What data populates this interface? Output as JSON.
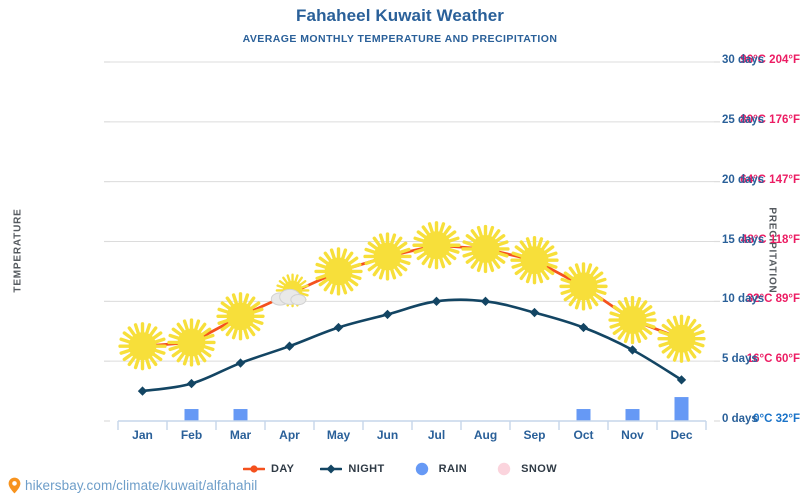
{
  "header": {
    "title": "Fahaheel Kuwait Weather",
    "subtitle": "AVERAGE MONTHLY TEMPERATURE AND PRECIPITATION"
  },
  "axes": {
    "left_title": "TEMPERATURE",
    "right_title": "PRECIPITATION"
  },
  "footer": {
    "url": "hikersbay.com/climate/kuwait/alfahahil",
    "pin_icon": "map-pin-icon"
  },
  "legend": {
    "items": [
      {
        "label": "DAY",
        "icon": "line-marker-icon",
        "color": "#f4511e"
      },
      {
        "label": "NIGHT",
        "icon": "line-marker-icon",
        "color": "#134563"
      },
      {
        "label": "RAIN",
        "icon": "circle-icon",
        "color": "#6699f5"
      },
      {
        "label": "SNOW",
        "icon": "circle-icon",
        "color": "#fbd4dd"
      }
    ]
  },
  "colors": {
    "day_line": "#f4511e",
    "night_line": "#134563",
    "rain_bar": "#6699f5",
    "snow": "#fbd4dd",
    "grid": "#dcdcdc",
    "axis_text_temp": "#ec1c63",
    "axis_text_precip": "#2a6099",
    "title": "#2a6099",
    "sun": "#f7df3a"
  },
  "chart_data": {
    "type": "line",
    "title": "Fahaheel Kuwait Weather",
    "subtitle": "AVERAGE MONTHLY TEMPERATURE AND PRECIPITATION",
    "xlabel": "",
    "ylabel": "TEMPERATURE",
    "y2label": "PRECIPITATION",
    "grid": true,
    "legend_position": "bottom",
    "categories": [
      "Jan",
      "Feb",
      "Mar",
      "Apr",
      "May",
      "Jun",
      "Jul",
      "Aug",
      "Sep",
      "Oct",
      "Nov",
      "Dec"
    ],
    "ylim": [
      0,
      96
    ],
    "y2lim": [
      0,
      30
    ],
    "yticks_left": [
      {
        "value": 0,
        "label": "0°C 32°F"
      },
      {
        "value": 16,
        "label": "16°C 60°F"
      },
      {
        "value": 32,
        "label": "32°C 89°F"
      },
      {
        "value": 48,
        "label": "48°C 118°F"
      },
      {
        "value": 64,
        "label": "64°C 147°F"
      },
      {
        "value": 80,
        "label": "80°C 176°F"
      },
      {
        "value": 96,
        "label": "96°C 204°F"
      }
    ],
    "yticks_right": [
      {
        "value": 0,
        "label": "0 days"
      },
      {
        "value": 5,
        "label": "5 days"
      },
      {
        "value": 10,
        "label": "10 days"
      },
      {
        "value": 15,
        "label": "15 days"
      },
      {
        "value": 20,
        "label": "20 days"
      },
      {
        "value": 25,
        "label": "25 days"
      },
      {
        "value": 30,
        "label": "30 days"
      }
    ],
    "series": [
      {
        "name": "DAY",
        "unit": "°C",
        "axis": "left",
        "color": "#f4511e",
        "values": [
          20,
          21,
          28,
          34,
          40,
          44,
          47,
          46,
          43,
          36,
          27,
          22
        ]
      },
      {
        "name": "NIGHT",
        "unit": "°C",
        "axis": "left",
        "color": "#134563",
        "values": [
          8,
          10,
          15.5,
          20,
          25,
          28.5,
          32,
          32,
          29,
          25,
          19,
          11
        ]
      },
      {
        "name": "RAIN",
        "unit": "days",
        "axis": "right",
        "type": "bar",
        "color": "#6699f5",
        "values": [
          0,
          1,
          1,
          0,
          0,
          0,
          0,
          0,
          0,
          1,
          1,
          2
        ]
      },
      {
        "name": "SNOW",
        "unit": "days",
        "axis": "right",
        "type": "bar",
        "color": "#fbd4dd",
        "values": [
          0,
          0,
          0,
          0,
          0,
          0,
          0,
          0,
          0,
          0,
          0,
          0
        ]
      }
    ],
    "weather_icons": [
      {
        "month": "Jan",
        "icon": "sun-icon"
      },
      {
        "month": "Feb",
        "icon": "sun-icon"
      },
      {
        "month": "Mar",
        "icon": "sun-icon"
      },
      {
        "month": "Apr",
        "icon": "sun-behind-cloud-icon"
      },
      {
        "month": "May",
        "icon": "sun-icon"
      },
      {
        "month": "Jun",
        "icon": "sun-icon"
      },
      {
        "month": "Jul",
        "icon": "sun-icon"
      },
      {
        "month": "Aug",
        "icon": "sun-icon"
      },
      {
        "month": "Sep",
        "icon": "sun-icon"
      },
      {
        "month": "Oct",
        "icon": "sun-icon"
      },
      {
        "month": "Nov",
        "icon": "sun-icon"
      },
      {
        "month": "Dec",
        "icon": "sun-icon"
      }
    ]
  }
}
